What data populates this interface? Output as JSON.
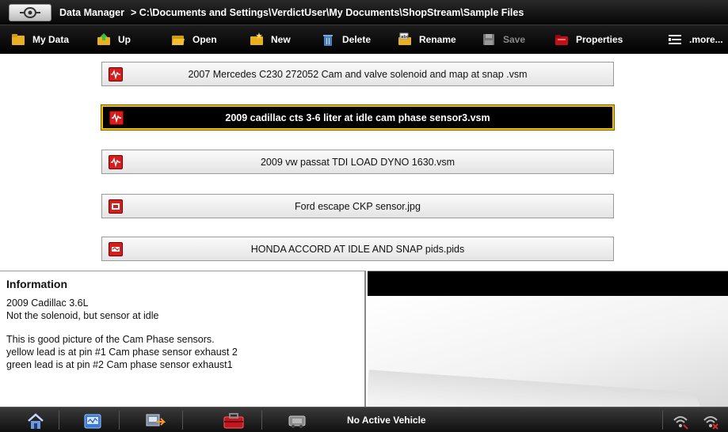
{
  "title_bar": {
    "app_title": "Data Manager",
    "path": "> C:\\Documents and Settings\\VerdictUser\\My Documents\\ShopStream\\Sample Files",
    "logo_icon": "snapon-logo-icon"
  },
  "toolbar": {
    "items": [
      {
        "label": "My Data",
        "icon": "folder-icon",
        "enabled": true
      },
      {
        "label": "Up",
        "icon": "folder-up-icon",
        "enabled": true
      },
      {
        "label": "Open",
        "icon": "folder-open-icon",
        "enabled": true
      },
      {
        "label": "New",
        "icon": "new-folder-icon",
        "enabled": true
      },
      {
        "label": "Delete",
        "icon": "trash-icon",
        "enabled": true
      },
      {
        "label": "Rename",
        "icon": "rename-icon",
        "enabled": true
      },
      {
        "label": "Save",
        "icon": "save-icon",
        "enabled": false
      },
      {
        "label": "Properties",
        "icon": "properties-icon",
        "enabled": true
      },
      {
        "label": ".more...",
        "icon": "more-menu-icon",
        "enabled": true
      }
    ]
  },
  "files": [
    {
      "name": "2007 Mercedes C230  272052 Cam and valve solenoid and map at snap .vsm",
      "icon": "waveform-file-icon",
      "selected": false
    },
    {
      "name": "2009 cadillac cts 3-6 liter at idle cam phase sensor3.vsm",
      "icon": "waveform-file-icon",
      "selected": true
    },
    {
      "name": "2009 vw passat TDI LOAD DYNO 1630.vsm",
      "icon": "waveform-file-icon",
      "selected": false
    },
    {
      "name": "Ford escape CKP sensor.jpg",
      "icon": "image-file-icon",
      "selected": false
    },
    {
      "name": "HONDA ACCORD AT IDLE AND SNAP pids.pids",
      "icon": "pids-file-icon",
      "selected": false
    }
  ],
  "information": {
    "title": "Information",
    "lines_top": [
      "2009 Cadillac 3.6L",
      "Not the solenoid, but sensor at idle"
    ],
    "lines_bottom": [
      "This is good picture of the Cam Phase sensors.",
      "yellow lead is at pin #1 Cam phase sensor exhaust 2",
      "green lead is at pin #2 Cam phase sensor exhaust1"
    ]
  },
  "taskbar": {
    "status": "No Active Vehicle",
    "buttons": [
      "home-icon",
      "scanner-icon",
      "data-transfer-icon",
      "toolbox-icon",
      "vehicle-icon"
    ],
    "right_icons": [
      "wifi-signal-icon",
      "wireless-connection-icon"
    ]
  },
  "colors": {
    "selected_border": "#f0c000",
    "file_icon_red": "#d41d1d",
    "bar_black": "#000000"
  }
}
